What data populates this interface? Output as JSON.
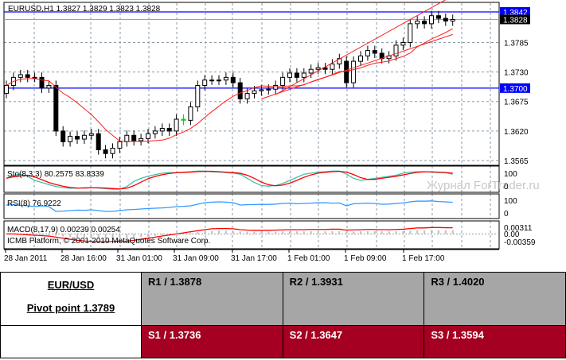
{
  "chart_header": "EURUSD,H1  1.3827 1.3829 1.3823 1.3828",
  "price_axis": {
    "ticks": [
      "1.3785",
      "1.3730",
      "1.3675",
      "1.3620",
      "1.3565"
    ],
    "tick_values": [
      1.3785,
      1.373,
      1.3675,
      1.362,
      1.3565
    ],
    "line_1": {
      "label": "1.3842",
      "value": 1.3842,
      "color": "#0000ff"
    },
    "line_2": {
      "label": "1.3700",
      "value": 1.37,
      "color": "#0000ff"
    },
    "current": {
      "label": "1.3828",
      "value": 1.3828
    }
  },
  "watermark": "Журнал ForTrader.ru",
  "chart_data": {
    "type": "candlestick",
    "symbol": "EURUSD",
    "timeframe": "H1",
    "ylim": [
      1.3565,
      1.3842
    ],
    "x_labels": [
      "28 Jan 2011",
      "28 Jan 16:00",
      "31 Jan 01:00",
      "31 Jan 09:00",
      "31 Jan 17:00",
      "1 Feb 01:00",
      "1 Feb 09:00",
      "1 Feb 17:00"
    ],
    "opens": [
      1.369,
      1.3705,
      1.372,
      1.3725,
      1.372,
      1.372,
      1.37,
      1.3705,
      1.362,
      1.36,
      1.361,
      1.3605,
      1.3612,
      1.3615,
      1.3585,
      1.3578,
      1.3588,
      1.36,
      1.3612,
      1.3602,
      1.3606,
      1.3615,
      1.362,
      1.3625,
      1.362,
      1.3642,
      1.364,
      1.3665,
      1.3705,
      1.3715,
      1.3715,
      1.3715,
      1.372,
      1.371,
      1.368,
      1.369,
      1.3695,
      1.3697,
      1.3698,
      1.3705,
      1.372,
      1.3728,
      1.372,
      1.3728,
      1.3735,
      1.3738,
      1.3735,
      1.3745,
      1.375,
      1.371,
      1.375,
      1.376,
      1.377,
      1.3765,
      1.3755,
      1.376,
      1.378,
      1.3785,
      1.382,
      1.3825,
      1.382,
      1.3835,
      1.383,
      1.3825
    ],
    "closes": [
      1.3705,
      1.372,
      1.3725,
      1.372,
      1.372,
      1.37,
      1.3705,
      1.362,
      1.36,
      1.361,
      1.3605,
      1.3612,
      1.3615,
      1.3585,
      1.3578,
      1.3588,
      1.36,
      1.3612,
      1.3602,
      1.3606,
      1.3615,
      1.362,
      1.3625,
      1.362,
      1.3642,
      1.364,
      1.3665,
      1.3705,
      1.3715,
      1.3715,
      1.3715,
      1.372,
      1.371,
      1.368,
      1.369,
      1.3695,
      1.3697,
      1.3698,
      1.3705,
      1.372,
      1.3728,
      1.372,
      1.3728,
      1.3735,
      1.3738,
      1.3735,
      1.3745,
      1.3755,
      1.371,
      1.375,
      1.376,
      1.377,
      1.3765,
      1.3755,
      1.376,
      1.378,
      1.3785,
      1.382,
      1.3825,
      1.382,
      1.3835,
      1.383,
      1.3825,
      1.3828
    ],
    "wick": 0.0009,
    "channel": {
      "upper": [
        [
          38,
          1.3688
        ],
        [
          63,
          1.3872
        ]
      ],
      "lower": [
        [
          36,
          1.368
        ],
        [
          63,
          1.38
        ]
      ]
    },
    "indicators": {
      "stochastic": {
        "label": "Sto(8,3,3) 80.2575 83.8339",
        "ticks": [
          "100",
          "0"
        ],
        "values": [
          60,
          75,
          80,
          70,
          50,
          40,
          30,
          20,
          15,
          12,
          12,
          15,
          15,
          13,
          10,
          8,
          8,
          20,
          45,
          60,
          70,
          78,
          85,
          88,
          88,
          90,
          92,
          95,
          95,
          92,
          90,
          88,
          85,
          80,
          60,
          40,
          25,
          22,
          25,
          35,
          50,
          65,
          80,
          85,
          90,
          92,
          95,
          95,
          80,
          60,
          50,
          55,
          60,
          65,
          70,
          75,
          85,
          90,
          92,
          92,
          90,
          88,
          87,
          80
        ]
      },
      "rsi": {
        "label": "RSI(8) 76.9222",
        "ticks": [
          "100",
          "0"
        ],
        "values": [
          60,
          62,
          58,
          55,
          50,
          55,
          50,
          20,
          22,
          25,
          28,
          27,
          30,
          25,
          20,
          20,
          25,
          30,
          32,
          35,
          38,
          40,
          42,
          45,
          50,
          52,
          55,
          65,
          75,
          78,
          80,
          78,
          75,
          60,
          62,
          63,
          64,
          64,
          66,
          70,
          72,
          68,
          70,
          72,
          74,
          75,
          72,
          73,
          55,
          68,
          70,
          72,
          70,
          65,
          66,
          70,
          73,
          80,
          85,
          84,
          86,
          82,
          80,
          77
        ]
      },
      "macd": {
        "label": "MACD(8,17,9) 0.00239 0.00254",
        "ticks": [
          "0.00311",
          "0.00",
          "-0.00359"
        ],
        "range": [
          -0.00359,
          0.00311
        ],
        "values": [
          0,
          0,
          -0.0002,
          -0.0004,
          -0.0006,
          -0.0008,
          -0.001,
          -0.0015,
          -0.002,
          -0.0025,
          -0.003,
          -0.0033,
          -0.0035,
          -0.0036,
          -0.0036,
          -0.0036,
          -0.0035,
          -0.0034,
          -0.003,
          -0.0025,
          -0.002,
          -0.0015,
          -0.001,
          -0.0005,
          0,
          0.0005,
          0.001,
          0.0015,
          0.002,
          0.0024,
          0.0025,
          0.0025,
          0.0024,
          0.002,
          0.0018,
          0.0017,
          0.0017,
          0.0017,
          0.0018,
          0.0019,
          0.002,
          0.002,
          0.002,
          0.0021,
          0.0021,
          0.0021,
          0.0022,
          0.0022,
          0.0018,
          0.0019,
          0.002,
          0.0021,
          0.0021,
          0.002,
          0.002,
          0.0021,
          0.0022,
          0.0025,
          0.0028,
          0.0028,
          0.003,
          0.003,
          0.0029,
          0.0029
        ]
      },
      "footer": "ICMB Platform, © 2001-2010 MetaQuotes Software Corp."
    }
  },
  "pivot_table": {
    "pair": "EUR/USD",
    "pivot": "Pivot point 1.3789",
    "resistance": [
      "R1 / 1.3878",
      "R2 / 1.3931",
      "R3 / 1.4020"
    ],
    "support": [
      "S1 / 1.3736",
      "S2 / 1.3647",
      "S3 / 1.3594"
    ],
    "colors": {
      "resistance": "#a6a6a6",
      "support": "#a50021"
    }
  }
}
